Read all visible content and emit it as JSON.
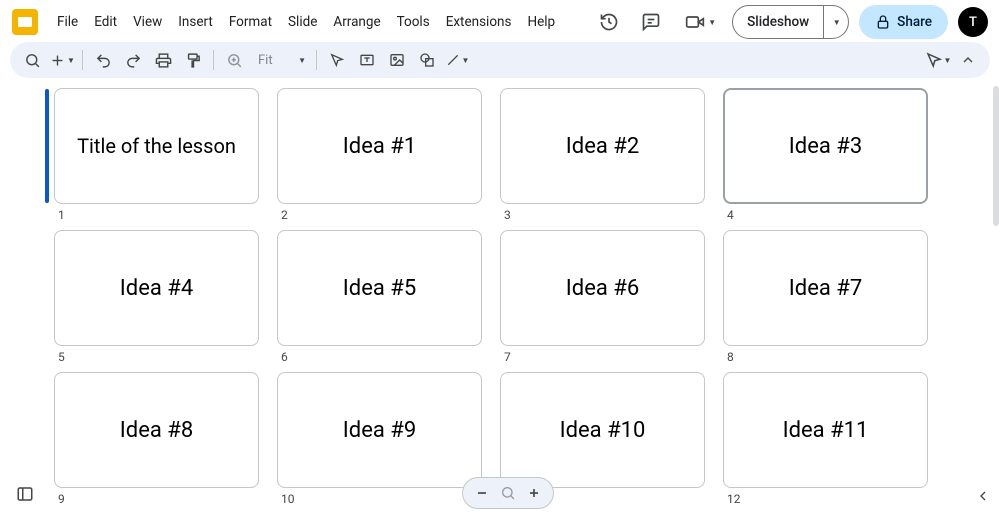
{
  "menu": {
    "items": [
      "File",
      "Edit",
      "View",
      "Insert",
      "Format",
      "Slide",
      "Arrange",
      "Tools",
      "Extensions",
      "Help"
    ]
  },
  "header": {
    "slideshow_label": "Slideshow",
    "share_label": "Share",
    "avatar_letter": "T"
  },
  "toolbar": {
    "fit_label": "Fit"
  },
  "slides": [
    {
      "text": "Title of the lesson",
      "number": "1",
      "current": true,
      "selected": false,
      "title": true
    },
    {
      "text": "Idea #1",
      "number": "2",
      "current": false,
      "selected": false
    },
    {
      "text": "Idea #2",
      "number": "3",
      "current": false,
      "selected": false
    },
    {
      "text": "Idea #3",
      "number": "4",
      "current": false,
      "selected": true
    },
    {
      "text": "Idea #4",
      "number": "5",
      "current": false,
      "selected": false
    },
    {
      "text": "Idea #5",
      "number": "6",
      "current": false,
      "selected": false
    },
    {
      "text": "Idea #6",
      "number": "7",
      "current": false,
      "selected": false
    },
    {
      "text": "Idea #7",
      "number": "8",
      "current": false,
      "selected": false
    },
    {
      "text": "Idea #8",
      "number": "9",
      "current": false,
      "selected": false
    },
    {
      "text": "Idea #9",
      "number": "10",
      "current": false,
      "selected": false
    },
    {
      "text": "Idea #10",
      "number": "11",
      "current": false,
      "selected": false
    },
    {
      "text": "Idea #11",
      "number": "12",
      "current": false,
      "selected": false
    }
  ]
}
